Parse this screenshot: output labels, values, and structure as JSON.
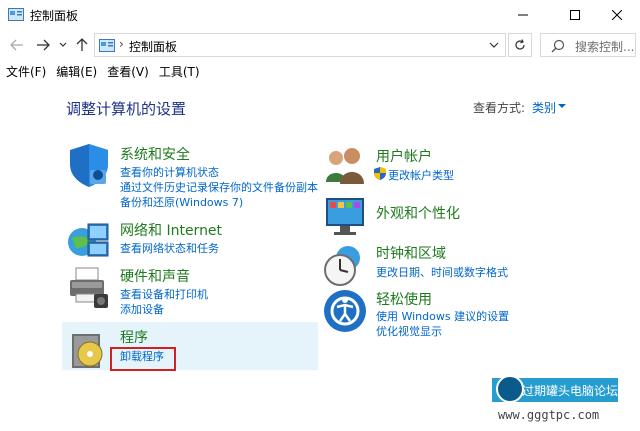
{
  "window": {
    "title": "控制面板"
  },
  "navbar": {
    "breadcrumb": "控制面板",
    "search_placeholder": "搜索控制..."
  },
  "menubar": {
    "items": [
      "文件(F)",
      "编辑(E)",
      "查看(V)",
      "工具(T)"
    ]
  },
  "content": {
    "heading": "调整计算机的设置",
    "view_by_label": "查看方式:",
    "view_by_value": "类别"
  },
  "categories": {
    "system": {
      "title": "系统和安全",
      "links": [
        "查看你的计算机状态",
        "通过文件历史记录保存你的文件备份副本",
        "备份和还原(Windows 7)"
      ]
    },
    "network": {
      "title": "网络和 Internet",
      "links": [
        "查看网络状态和任务"
      ]
    },
    "hardware": {
      "title": "硬件和声音",
      "links": [
        "查看设备和打印机",
        "添加设备"
      ]
    },
    "programs": {
      "title": "程序",
      "links": [
        "卸载程序"
      ]
    },
    "accounts": {
      "title": "用户帐户",
      "links": [
        "更改帐户类型"
      ]
    },
    "appearance": {
      "title": "外观和个性化",
      "links": []
    },
    "clock": {
      "title": "时钟和区域",
      "links": [
        "更改日期、时间或数字格式"
      ]
    },
    "ease": {
      "title": "轻松使用",
      "links": [
        "使用 Windows 建议的设置",
        "优化视觉显示"
      ]
    }
  },
  "watermark": {
    "text": "过期罐头电脑论坛",
    "url": "www.gggtpc.com"
  },
  "colors": {
    "category_title": "#1e7a1e",
    "link": "#0066cc",
    "heading": "#1e3287",
    "highlight_bg": "#e5f3fb",
    "annotation_box": "#d21f1f"
  }
}
